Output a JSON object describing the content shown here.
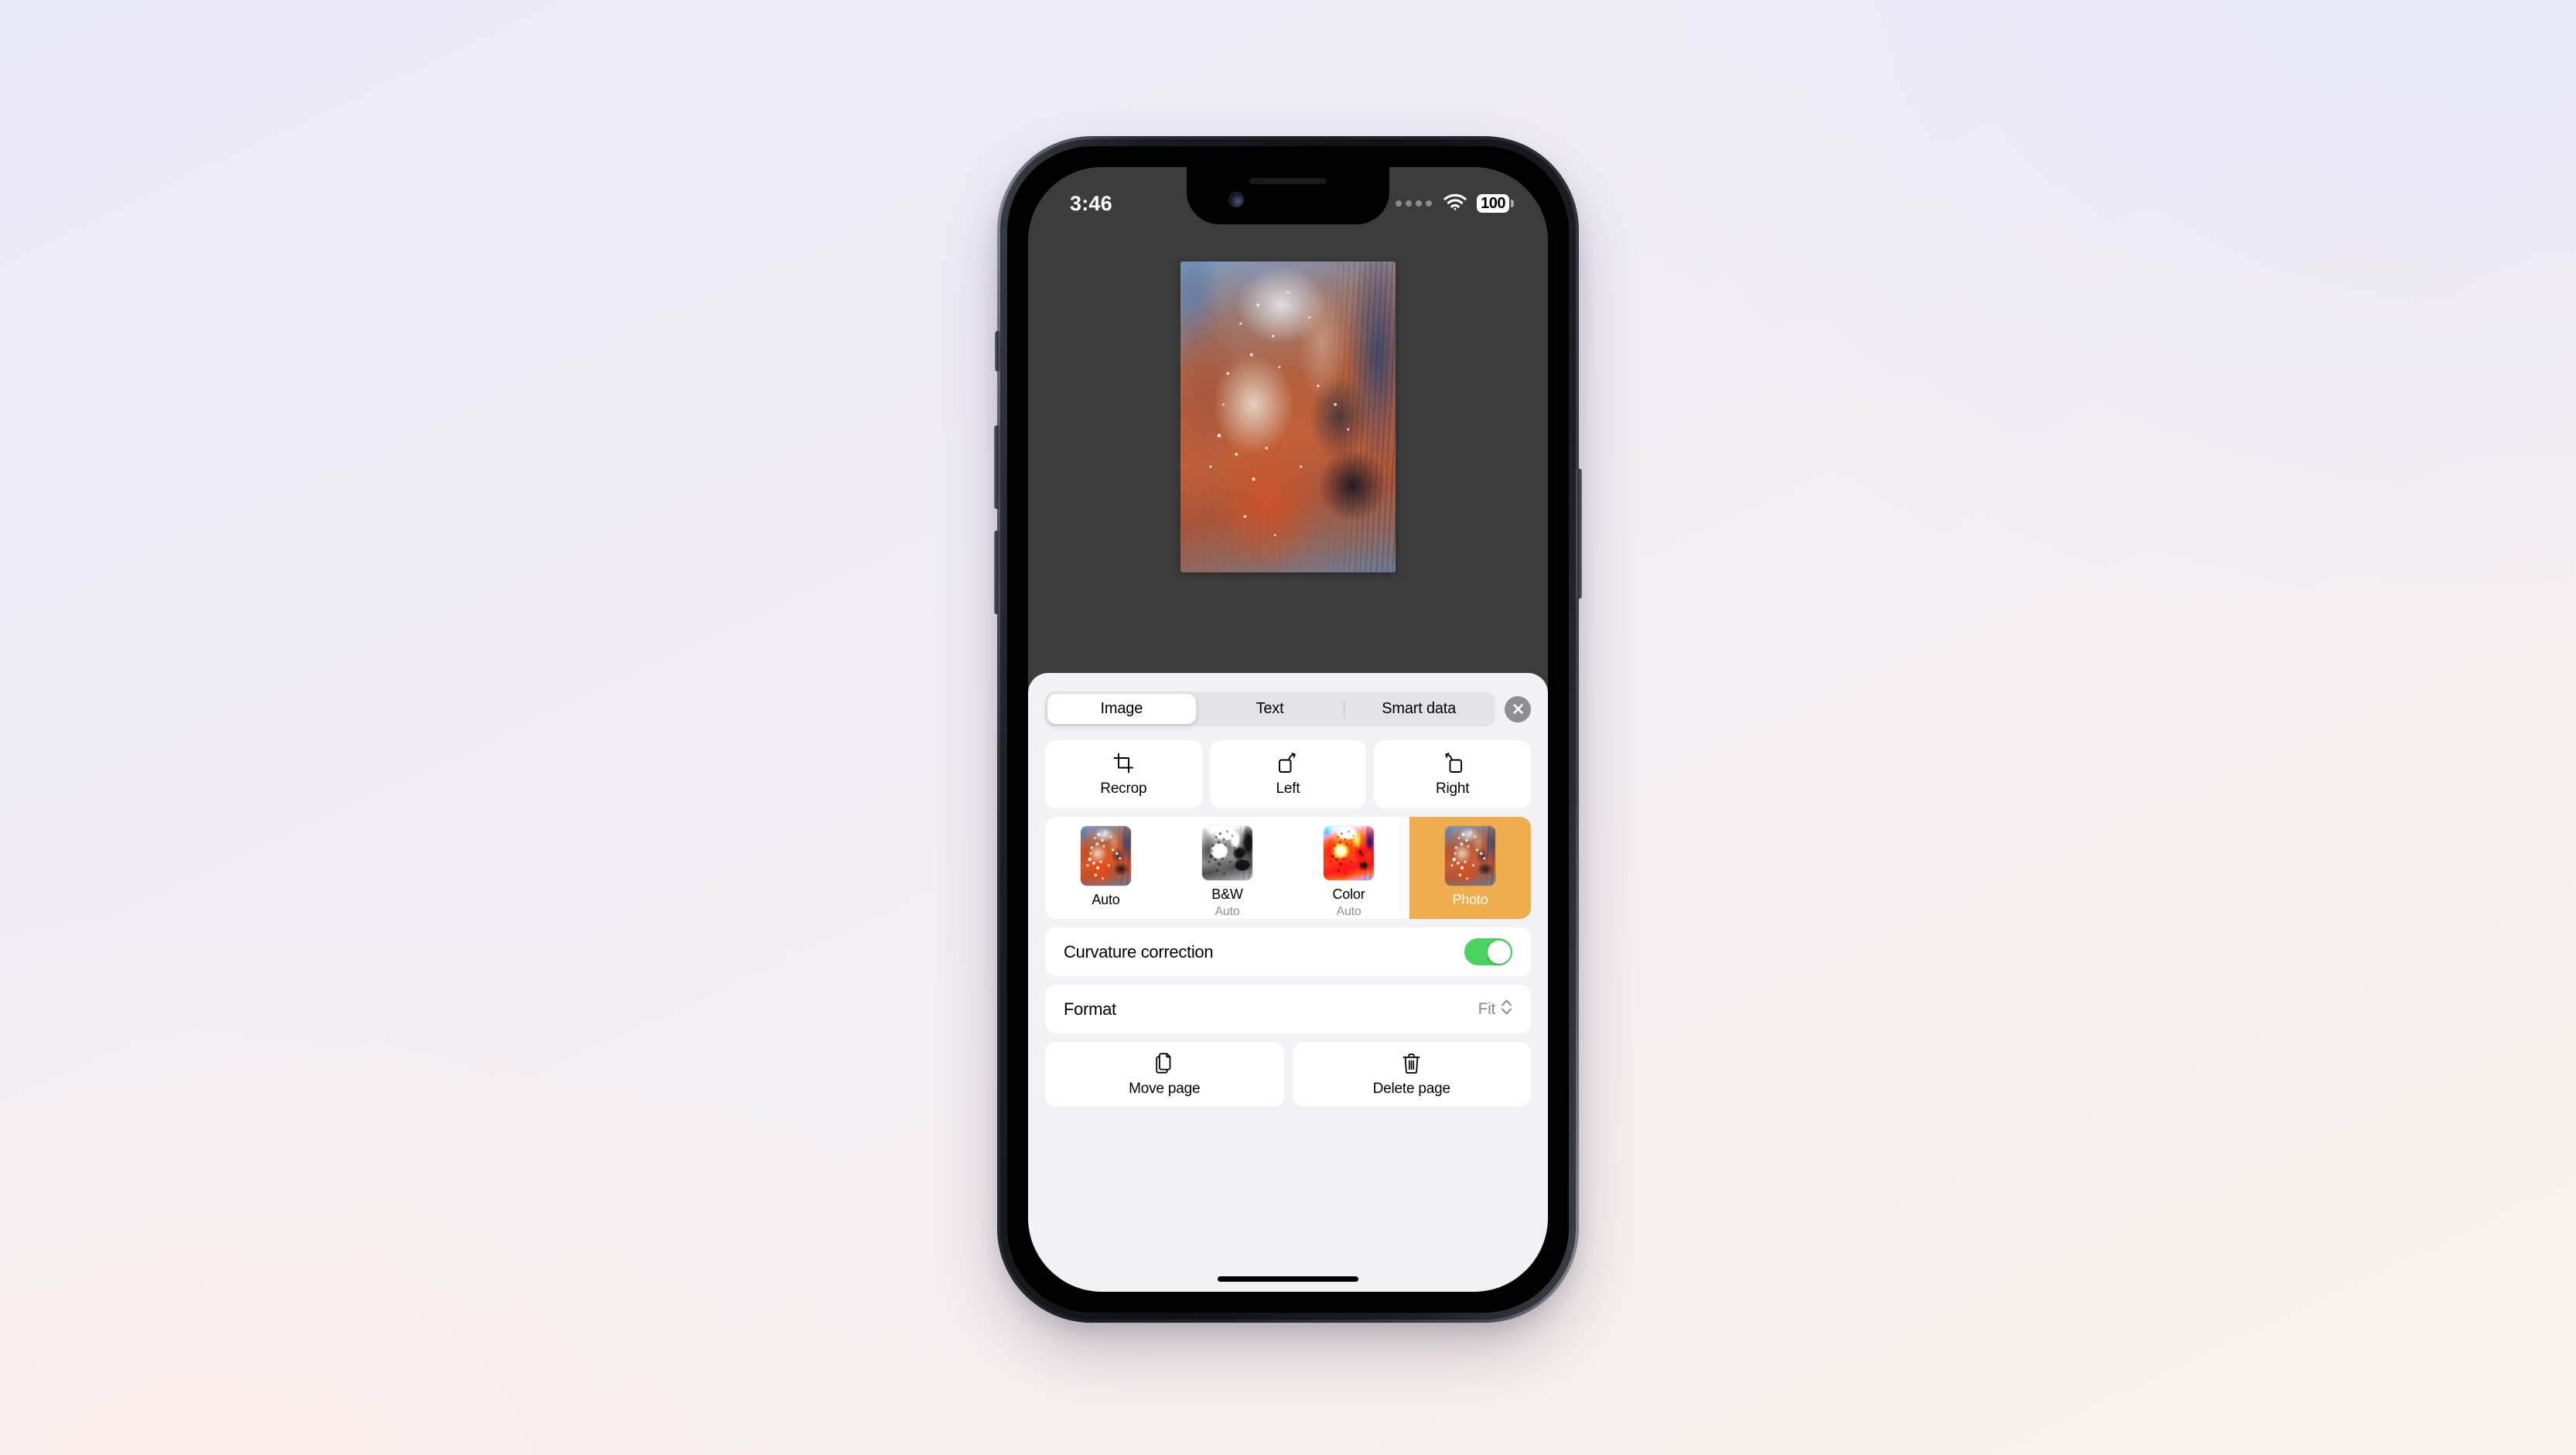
{
  "status_bar": {
    "time": "3:46",
    "signal_icon": "cellular-dots-icon",
    "wifi_icon": "wifi-icon",
    "battery_level": "100"
  },
  "preview": {
    "page_image_alt": "scanned-page-abstract-painting"
  },
  "sheet": {
    "tabs": [
      {
        "label": "Image",
        "selected": true
      },
      {
        "label": "Text",
        "selected": false
      },
      {
        "label": "Smart data",
        "selected": false
      }
    ],
    "close_label": "×",
    "actions": [
      {
        "label": "Recrop",
        "icon": "crop-icon"
      },
      {
        "label": "Left",
        "icon": "rotate-left-icon"
      },
      {
        "label": "Right",
        "icon": "rotate-right-icon"
      }
    ],
    "filters": [
      {
        "label": "Auto",
        "sublabel": "",
        "selected": false
      },
      {
        "label": "B&W",
        "sublabel": "Auto",
        "selected": false
      },
      {
        "label": "Color",
        "sublabel": "Auto",
        "selected": false
      },
      {
        "label": "Photo",
        "sublabel": "",
        "selected": true
      }
    ],
    "curvature": {
      "label": "Curvature correction",
      "enabled": true
    },
    "format": {
      "label": "Format",
      "value": "Fit"
    },
    "page_actions": [
      {
        "label": "Move page",
        "icon": "duplicate-document-icon"
      },
      {
        "label": "Delete page",
        "icon": "trash-icon"
      }
    ]
  },
  "colors": {
    "accent_selected": "#EFAE4E",
    "toggle_on": "#4BD25F",
    "sheet_bg": "#F1F1F6",
    "card_bg": "#FFFFFF",
    "secondary_text": "#8E8E93",
    "preview_bg": "#3C3C3C"
  }
}
